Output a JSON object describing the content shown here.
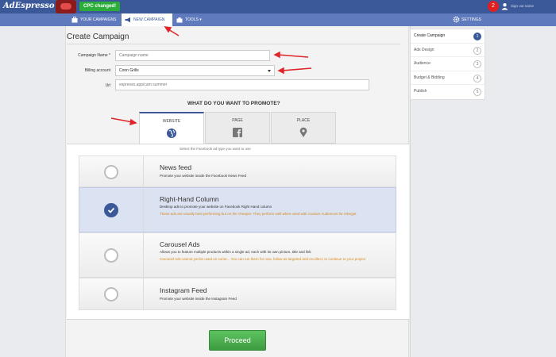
{
  "header": {
    "logo": "AdEspresso",
    "cpc_button": "CPC changed!",
    "notification_count": "2",
    "user_name": "Sign out name"
  },
  "nav": {
    "campaigns": "YOUR CAMPAIGNS",
    "new_campaign": "NEW CAMPAIGN",
    "tools": "TOOLS ▾",
    "settings": "SETTINGS"
  },
  "form": {
    "title": "Create Campaign",
    "campaign_name_label": "Campaign Name *",
    "campaign_name_placeholder": "Campaign name",
    "billing_label": "Billing account",
    "billing_value": "Conn Grills",
    "url_label": "Url",
    "url_value": "espresso.app/cam summer"
  },
  "promote": {
    "heading": "WHAT DO YOU WANT TO PROMOTE?",
    "tabs": [
      {
        "label": "WEBSITE",
        "icon": "globe-icon"
      },
      {
        "label": "PAGE",
        "icon": "facebook-icon"
      },
      {
        "label": "PLACE",
        "icon": "map-pin-icon"
      }
    ],
    "hint": "Select the Facebook ad type you want to use"
  },
  "placements": [
    {
      "title": "News feed",
      "desc": "Promote your website inside the Facebook News Feed",
      "warning": "",
      "selected": false
    },
    {
      "title": "Right-Hand Column",
      "desc": "Desktop ads to promote your website on Facebook Right Hand column",
      "warning": "These ads are usually best performing but on the cheaper. They perform well when used with Custom Audiences for retarget",
      "selected": true
    },
    {
      "title": "Carousel Ads",
      "desc": "Allows you to feature multiple products within a single ad, each with its own picture, title and link",
      "warning": "Carousel Ads cannot yet be used on some... You can run them for now, follow as targeted and recollect, to continue to your project",
      "selected": false
    },
    {
      "title": "Instagram Feed",
      "desc": "Promote your website inside the Instagram Feed",
      "warning": "",
      "selected": false
    }
  ],
  "proceed_label": "Proceed",
  "steps": [
    {
      "label": "Create Campaign",
      "num": "1",
      "active": true
    },
    {
      "label": "Ads Design",
      "num": "2",
      "active": false
    },
    {
      "label": "Audience",
      "num": "3",
      "active": false
    },
    {
      "label": "Budget & Bidding",
      "num": "4",
      "active": false
    },
    {
      "label": "Publish",
      "num": "5",
      "active": false
    }
  ],
  "colors": {
    "brand": "#3b5998",
    "nav": "#5f7bbd",
    "proceed": "#4cae4f",
    "warning": "#d98a1c",
    "annotation": "#e0242a"
  }
}
